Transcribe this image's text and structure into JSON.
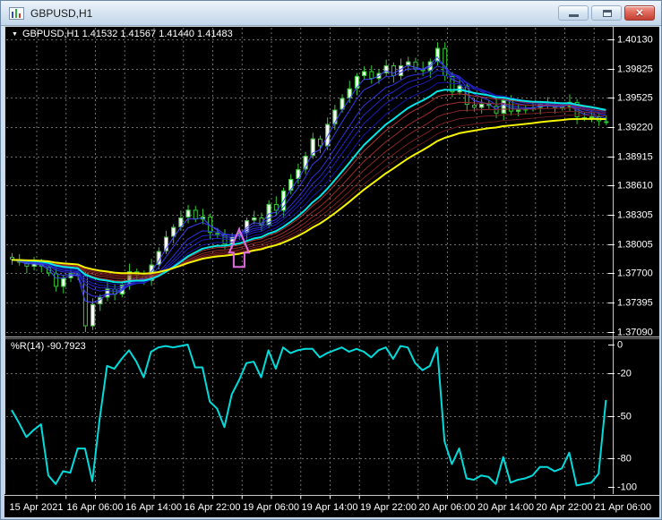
{
  "window": {
    "title": "GBPUSD,H1",
    "buttons": {
      "minimize": "minimize",
      "restore": "restore",
      "close": "close"
    }
  },
  "legend": {
    "symbol": "GBPUSD",
    "timeframe": "H1",
    "open": "1.41532",
    "high": "1.41567",
    "low": "1.41440",
    "close": "1.41483",
    "text": "GBPUSD,H1 1.41532 1.41567 1.41440 1.41483"
  },
  "indicator_label": "%R(14) -90.7923",
  "chart_data": {
    "type": "candlestick",
    "title": "GBPUSD,H1",
    "grid": true,
    "price_axis": {
      "max": 1.4013,
      "min": 1.3709,
      "labels": [
        "1.40130",
        "1.39825",
        "1.39525",
        "1.39220",
        "1.38915",
        "1.38610",
        "1.38305",
        "1.38005",
        "1.37700",
        "1.37395",
        "1.37090"
      ],
      "label_values": [
        1.4013,
        1.39825,
        1.39525,
        1.3922,
        1.38915,
        1.3861,
        1.38305,
        1.38005,
        1.377,
        1.37395,
        1.3709
      ]
    },
    "time_axis": {
      "labels": [
        "15 Apr 2021",
        "16 Apr 06:00",
        "16 Apr 14:00",
        "16 Apr 22:00",
        "19 Apr 06:00",
        "19 Apr 14:00",
        "19 Apr 22:00",
        "20 Apr 06:00",
        "20 Apr 14:00",
        "20 Apr 22:00",
        "21 Apr 06:00"
      ]
    },
    "wpr_axis": {
      "labels": [
        "0",
        "-20",
        "-50",
        "-80",
        "-100"
      ],
      "label_values": [
        0,
        -20,
        -50,
        -80,
        -100
      ],
      "grid_values": [
        -20,
        -50,
        -80
      ],
      "range": [
        0,
        -100
      ]
    },
    "candles": {
      "open_first": 1.3787,
      "opens_derived_from_prev_close": true,
      "closes": [
        1.3784,
        1.3781,
        1.3777,
        1.378,
        1.3777,
        1.377,
        1.3756,
        1.3765,
        1.377,
        1.3768,
        1.3715,
        1.3738,
        1.3745,
        1.3754,
        1.3748,
        1.3758,
        1.3772,
        1.3768,
        1.3762,
        1.3779,
        1.3793,
        1.3808,
        1.3818,
        1.3828,
        1.3836,
        1.3826,
        1.3829,
        1.3812,
        1.381,
        1.38,
        1.3808,
        1.3812,
        1.3825,
        1.3828,
        1.382,
        1.3842,
        1.3835,
        1.3856,
        1.3868,
        1.3878,
        1.3892,
        1.391,
        1.3902,
        1.3925,
        1.394,
        1.3952,
        1.3962,
        1.3975,
        1.398,
        1.3972,
        1.3978,
        1.3986,
        1.3975,
        1.3986,
        1.399,
        1.3982,
        1.398,
        1.399,
        1.4004,
        1.3975,
        1.3958,
        1.3965,
        1.3945,
        1.3942,
        1.3946,
        1.3944,
        1.3936,
        1.395,
        1.3938,
        1.394,
        1.3941,
        1.3942,
        1.3946,
        1.3945,
        1.3942,
        1.3943,
        1.3948,
        1.3932,
        1.3932,
        1.3933,
        1.3928,
        1.3927
      ],
      "high_wick_pattern_1e4": [
        4,
        6,
        3,
        7,
        5,
        4,
        8,
        3,
        5,
        6
      ],
      "low_wick_pattern_1e4": [
        5,
        3,
        7,
        4,
        6,
        3,
        5,
        7,
        4,
        5
      ],
      "wick_overrides": {
        "high": {
          "58": 6
        },
        "low": {
          "10": 6,
          "11": 4
        }
      }
    },
    "moving_averages": [
      {
        "period": 3,
        "color": "#4747ff",
        "width": 1,
        "group": "fast-ribbon"
      },
      {
        "period": 5,
        "color": "#3b3bef",
        "width": 1,
        "group": "fast-ribbon"
      },
      {
        "period": 8,
        "color": "#3030df",
        "width": 1,
        "group": "fast-ribbon"
      },
      {
        "period": 10,
        "color": "#2626cf",
        "width": 1,
        "group": "fast-ribbon"
      },
      {
        "period": 12,
        "color": "#1d1dbf",
        "width": 1,
        "group": "fast-ribbon"
      },
      {
        "period": 15,
        "color": "#1414af",
        "width": 1,
        "group": "fast-ribbon"
      },
      {
        "period": 20,
        "color": "#b03232",
        "width": 1,
        "group": "slow-ribbon"
      },
      {
        "period": 24,
        "color": "#9e2b2b",
        "width": 1,
        "group": "slow-ribbon"
      },
      {
        "period": 28,
        "color": "#8c2525",
        "width": 1,
        "group": "slow-ribbon"
      },
      {
        "period": 32,
        "color": "#7a1f1f",
        "width": 1,
        "group": "slow-ribbon"
      },
      {
        "period": 36,
        "color": "#681a1a",
        "width": 1,
        "group": "slow-ribbon"
      },
      {
        "period": 18,
        "color": "#00e8e8",
        "width": 2,
        "group": "signal"
      },
      {
        "period": 40,
        "color": "#f5f500",
        "width": 2,
        "group": "baseline"
      }
    ],
    "wpr": {
      "name": "%R",
      "period": 14,
      "current_value": -90.7923,
      "color": "#00dcdc",
      "values": [
        -46,
        -55,
        -65,
        -60,
        -56,
        -92,
        -98,
        -89,
        -90,
        -73,
        -73,
        -96,
        -52,
        -15,
        -17,
        -10,
        -4,
        -12,
        -23,
        -5,
        -2,
        -1,
        -2,
        -1,
        0,
        -16,
        -16,
        -40,
        -45,
        -58,
        -35,
        -25,
        -13,
        -12,
        -23,
        -4,
        -17,
        -2,
        -6,
        -4,
        -3,
        -3,
        -9,
        -6,
        -4,
        -2,
        -5,
        -3,
        -5,
        -9,
        -4,
        -2,
        -10,
        -1,
        -2,
        -13,
        -18,
        -15,
        -2,
        -68,
        -84,
        -73,
        -94,
        -95,
        -92,
        -93,
        -98,
        -79,
        -97,
        -95,
        -94,
        -92,
        -86,
        -86,
        -89,
        -87,
        -76,
        -99,
        -98,
        -97,
        -90.79,
        -39
      ]
    },
    "arrow": {
      "bar_index": 31,
      "type": "up-arrow",
      "color": "#e06ae0"
    },
    "colors": {
      "background": "#000000",
      "grid": "#6f6f6f",
      "axis_text": "#ffffff",
      "candle_outline": "#33cc33",
      "bull_fill": "#ffffff",
      "bear_fill": "#000000",
      "separator": "#c8c8c8"
    }
  }
}
